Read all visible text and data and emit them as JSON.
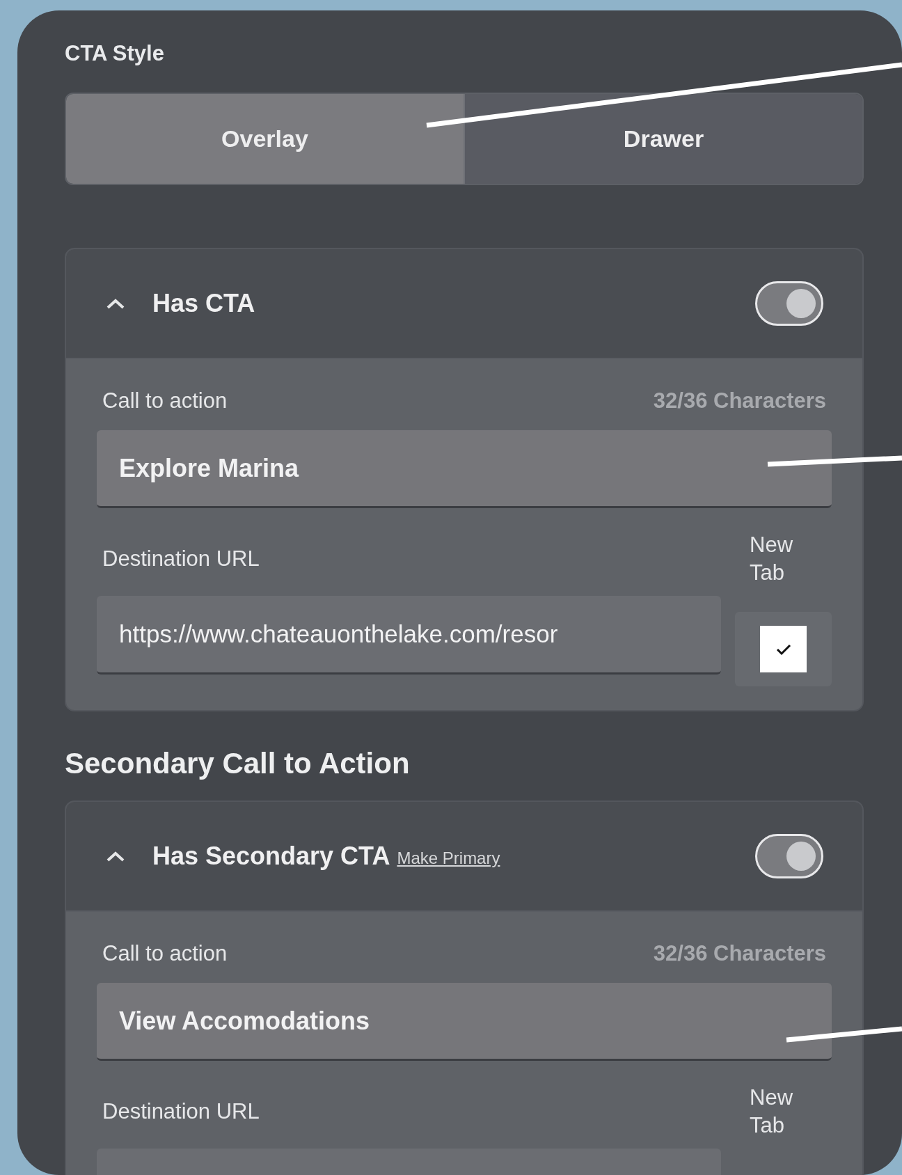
{
  "cta_style": {
    "label": "CTA Style",
    "options": [
      {
        "label": "Overlay",
        "selected": true
      },
      {
        "label": "Drawer",
        "selected": false
      }
    ]
  },
  "cards": [
    {
      "title": "Has CTA",
      "expanded": true,
      "on": true,
      "cta_label": "Call to action",
      "counter": "32/36 Characters",
      "cta_value": "Explore Marina",
      "url_label": "Destination URL",
      "new_tab_label": "New Tab",
      "url_value": "https://www.chateauonthelake.com/resor",
      "new_tab_checked": true
    },
    {
      "heading": "Secondary Call to Action",
      "title": "Has Secondary CTA",
      "link": "Make Primary",
      "expanded": true,
      "on": true,
      "cta_label": "Call to action",
      "counter": "32/36 Characters",
      "cta_value": "View Accomodations",
      "url_label": "Destination URL",
      "new_tab_label": "New Tab"
    }
  ]
}
